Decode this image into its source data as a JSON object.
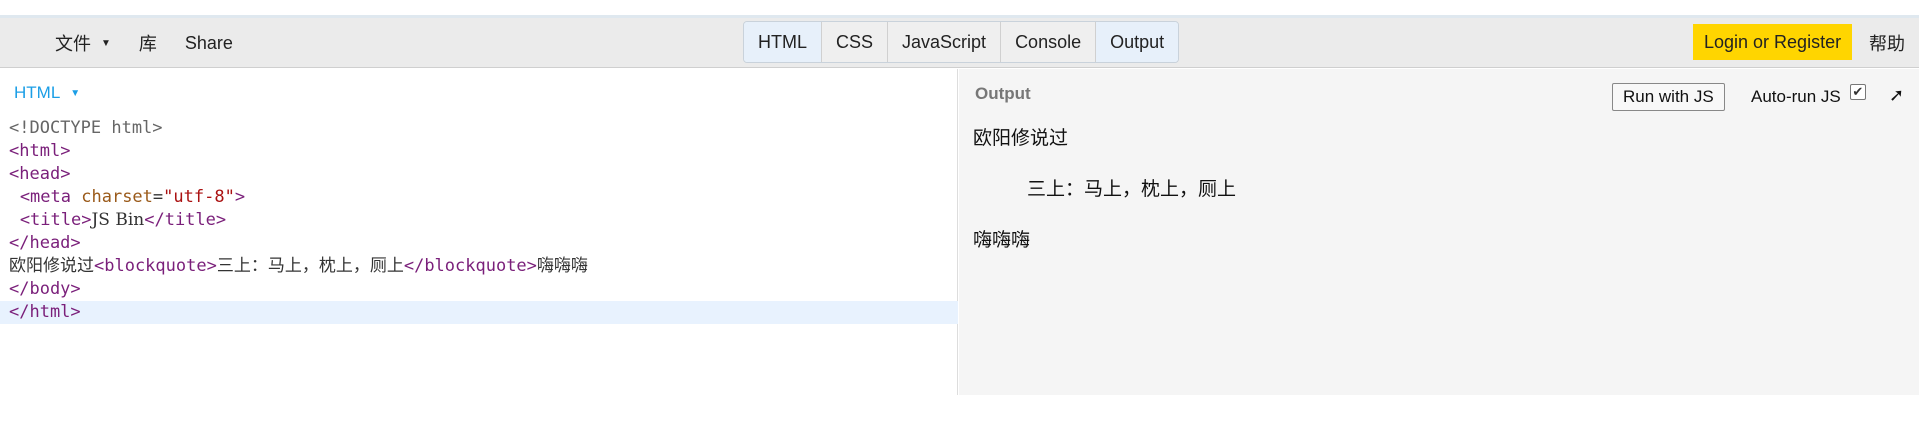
{
  "toolbar": {
    "menu": [
      {
        "label": "文件",
        "has_caret": true
      },
      {
        "label": "库"
      },
      {
        "label": "Share"
      }
    ],
    "tabs": [
      {
        "label": "HTML",
        "active": true
      },
      {
        "label": "CSS",
        "active": false
      },
      {
        "label": "JavaScript",
        "active": false
      },
      {
        "label": "Console",
        "active": false
      },
      {
        "label": "Output",
        "active": true
      }
    ],
    "login_label": "Login or Register",
    "help_label": "帮助",
    "login_color": "#ffd500"
  },
  "editor": {
    "panel_label": "HTML",
    "lines": [
      "<!DOCTYPE html>",
      "<html>",
      "<head>",
      "  <meta charset=\"utf-8\">",
      "  <title>JS Bin</title>",
      "</head>",
      "欧阳修说过<blockquote>三上：马上，枕上，厕上</blockquote>嗨嗨嗨",
      "</body>",
      "</html>"
    ],
    "highlighted_line": 9
  },
  "output": {
    "panel_label": "Output",
    "run_button_label": "Run with JS",
    "autorun_label": "Auto-run JS",
    "autorun_checked": true,
    "rendered": {
      "para1": "欧阳修说过",
      "quote": "三上：马上，枕上，厕上",
      "para2": "嗨嗨嗨"
    }
  },
  "icons": {
    "dropdown": "caret-down-icon",
    "checkbox": "checkbox-checked-icon",
    "popout": "arrow-up-right-icon"
  }
}
